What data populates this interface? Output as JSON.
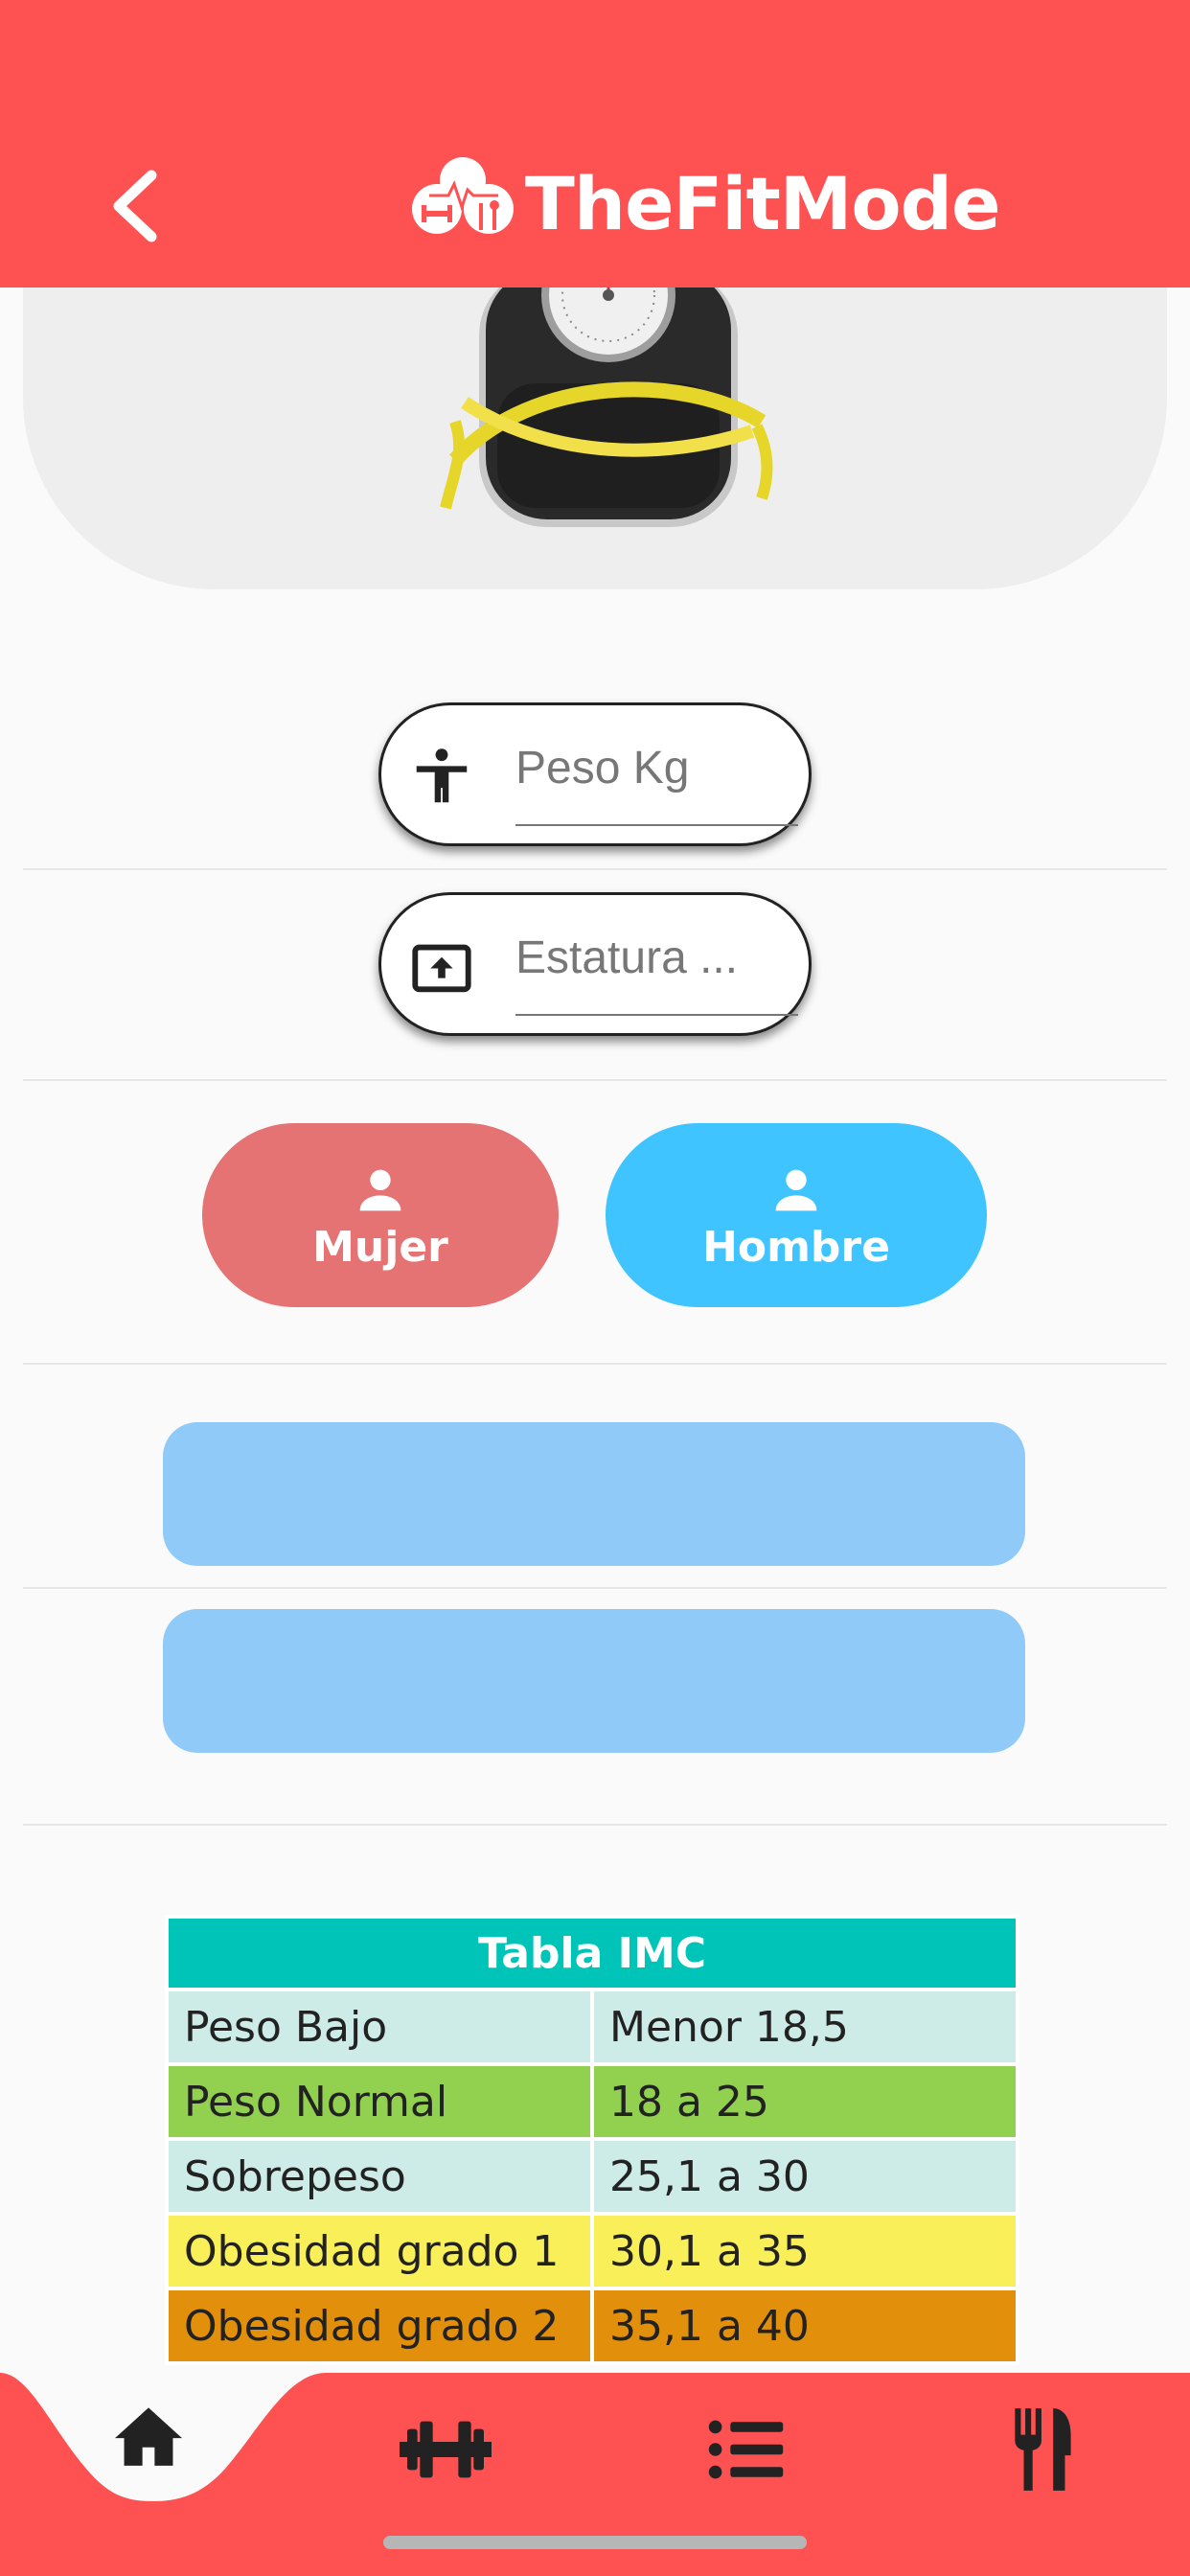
{
  "header": {
    "brand_name": "TheFitMode",
    "back_icon": "chevron-left-icon"
  },
  "hero": {
    "image": "bathroom-scale-with-measuring-tape"
  },
  "form": {
    "weight": {
      "placeholder": "Peso Kg",
      "icon": "accessibility-icon"
    },
    "height": {
      "placeholder": "Estatura ...",
      "icon": "height-upload-icon"
    }
  },
  "gender": {
    "female_label": "Mujer",
    "male_label": "Hombre",
    "icon": "person-icon"
  },
  "colors": {
    "primary": "#fe5151",
    "female": "#e57373",
    "male": "#40c4ff",
    "result_bar": "#90caf9",
    "table_header": "#00c4b8"
  },
  "imc_table": {
    "title": "Tabla IMC",
    "rows": [
      {
        "label": "Peso Bajo",
        "range": "Menor 18,5",
        "color": "#cdebe7"
      },
      {
        "label": "Peso Normal",
        "range": "18 a 25",
        "color": "#92d050"
      },
      {
        "label": "Sobrepeso",
        "range": "25,1 a 30",
        "color": "#cdebe7"
      },
      {
        "label": "Obesidad grado 1",
        "range": "30,1 a 35",
        "color": "#f8ef59"
      },
      {
        "label": "Obesidad grado 2",
        "range": "35,1 a 40",
        "color": "#e2900c"
      }
    ]
  },
  "bottom_nav": {
    "items": [
      "home-icon",
      "dumbbell-icon",
      "list-icon",
      "utensils-icon"
    ],
    "active": "home-icon"
  }
}
